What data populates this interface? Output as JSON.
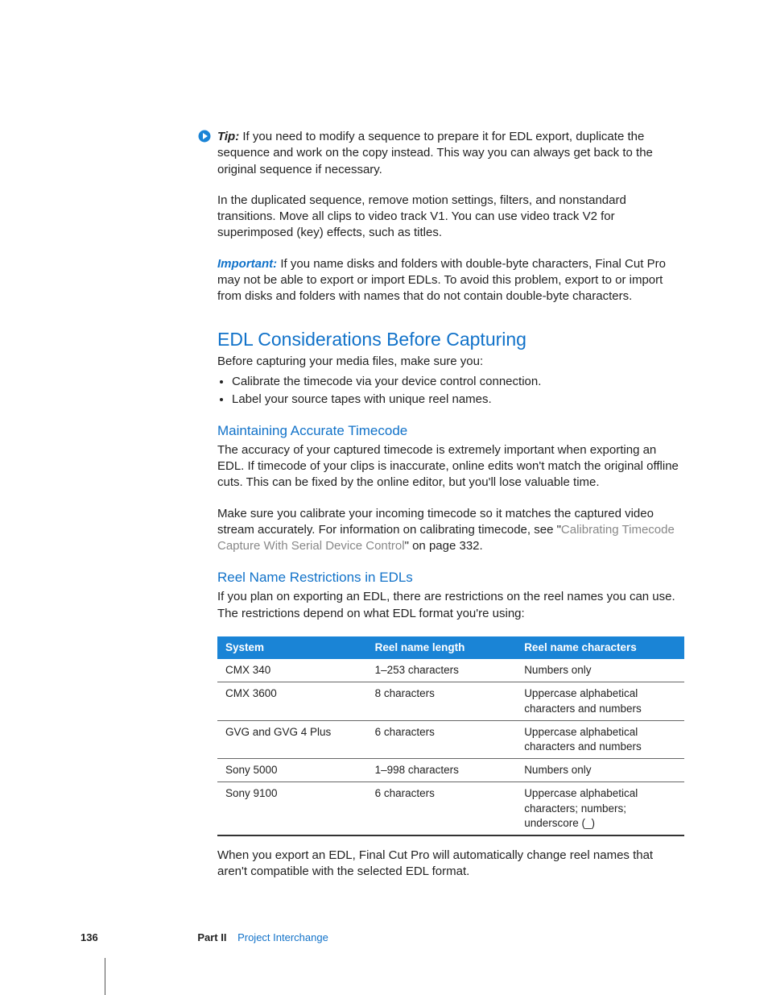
{
  "tip": {
    "label": "Tip:",
    "text": "If you need to modify a sequence to prepare it for EDL export, duplicate the sequence and work on the copy instead. This way you can always get back to the original sequence if necessary."
  },
  "tip_followup": "In the duplicated sequence, remove motion settings, filters, and nonstandard transitions. Move all clips to video track V1. You can use video track V2 for superimposed (key) effects, such as titles.",
  "important": {
    "label": "Important:",
    "text": "If you name disks and folders with double-byte characters, Final Cut Pro may not be able to export or import EDLs. To avoid this problem, export to or import from disks and folders with names that do not contain double-byte characters."
  },
  "section": {
    "title": "EDL Considerations Before Capturing",
    "intro": "Before capturing your media files, make sure you:",
    "bullets": [
      "Calibrate the timecode via your device control connection.",
      "Label your source tapes with unique reel names."
    ]
  },
  "sub1": {
    "title": "Maintaining Accurate Timecode",
    "p1": "The accuracy of your captured timecode is extremely important when exporting an EDL. If timecode of your clips is inaccurate, online edits won't match the original offline cuts. This can be fixed by the online editor, but you'll lose valuable time.",
    "p2a": "Make sure you calibrate your incoming timecode so it matches the captured video stream accurately. For information on calibrating timecode, see \"",
    "p2_xref": "Calibrating Timecode Capture With Serial Device Control",
    "p2b": "\" on page 332."
  },
  "sub2": {
    "title": "Reel Name Restrictions in EDLs",
    "intro": "If you plan on exporting an EDL, there are restrictions on the reel names you can use. The restrictions depend on what EDL format you're using:",
    "table": {
      "headers": [
        "System",
        "Reel name length",
        "Reel name characters"
      ],
      "rows": [
        [
          "CMX 340",
          "1–253 characters",
          "Numbers only"
        ],
        [
          "CMX 3600",
          "8 characters",
          "Uppercase alphabetical characters and numbers"
        ],
        [
          "GVG and GVG 4 Plus",
          "6 characters",
          "Uppercase alphabetical characters and numbers"
        ],
        [
          "Sony 5000",
          "1–998 characters",
          "Numbers only"
        ],
        [
          "Sony 9100",
          "6 characters",
          "Uppercase alphabetical characters; numbers; underscore (_)"
        ]
      ]
    },
    "outro": "When you export an EDL, Final Cut Pro will automatically change reel names that aren't compatible with the selected EDL format."
  },
  "footer": {
    "page": "136",
    "part": "Part II",
    "title": "Project Interchange"
  }
}
